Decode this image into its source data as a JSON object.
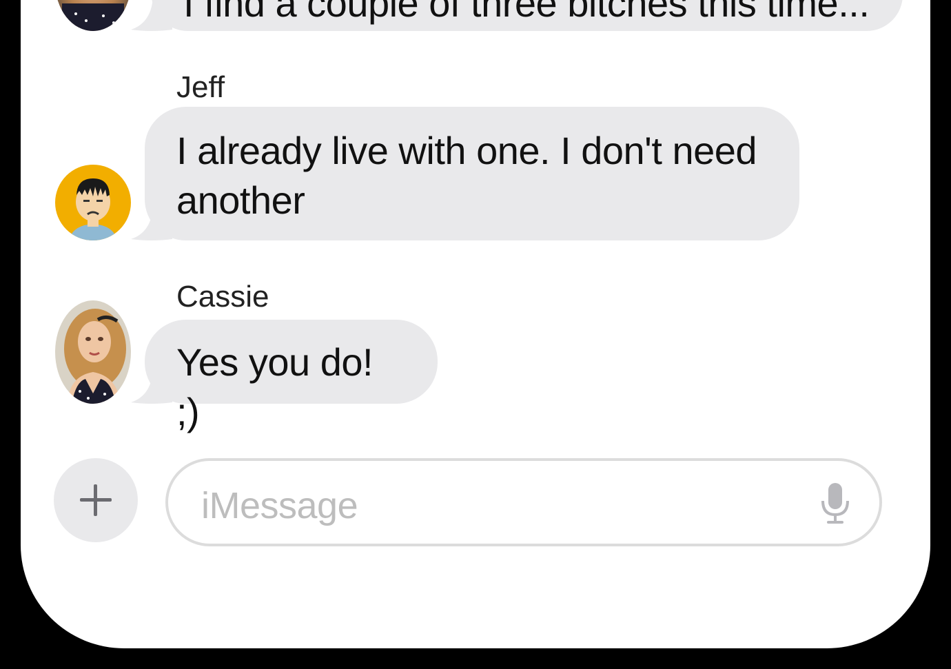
{
  "messages": [
    {
      "sender": "",
      "text": "I find a couple of three bitches this time..."
    },
    {
      "sender": "Jeff",
      "text_lines": [
        "I already live with one.  I don't need",
        "another"
      ]
    },
    {
      "sender": "Cassie",
      "text": "Yes you do! ;)"
    }
  ],
  "composer": {
    "placeholder": "iMessage"
  },
  "colors": {
    "bubble": "#e9e9eb",
    "jeff_avatar_bg": "#f2ae00",
    "placeholder": "#bdbdbd"
  },
  "icons": {
    "add": "plus-icon",
    "mic": "microphone-icon"
  }
}
